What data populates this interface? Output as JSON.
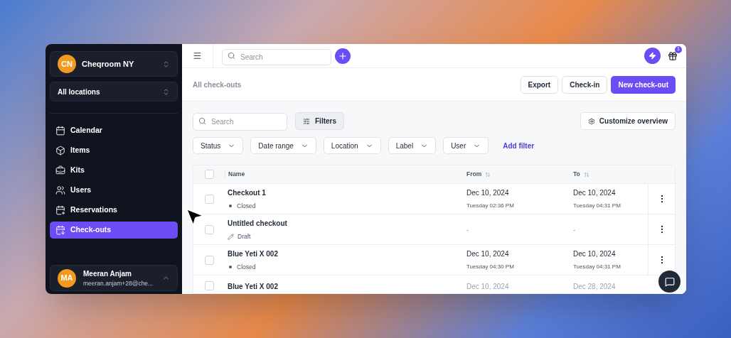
{
  "sidebar": {
    "org": {
      "initials": "CN",
      "name": "Cheqroom NY"
    },
    "location": "All locations",
    "items": [
      {
        "label": "Calendar",
        "selected": false
      },
      {
        "label": "Items",
        "selected": false
      },
      {
        "label": "Kits",
        "selected": false
      },
      {
        "label": "Users",
        "selected": false
      },
      {
        "label": "Reservations",
        "selected": false
      },
      {
        "label": "Check-outs",
        "selected": true
      }
    ],
    "user": {
      "initials": "MA",
      "name": "Meeran Anjam",
      "email": "meeran.anjam+28@che..."
    }
  },
  "topbar": {
    "search_placeholder": "Search",
    "badge": "1"
  },
  "header": {
    "title": "All check-outs",
    "buttons": [
      {
        "label": "Export",
        "kind": "outline"
      },
      {
        "label": "Check-in",
        "kind": "outline"
      },
      {
        "label": "New check-out",
        "kind": "primary"
      }
    ]
  },
  "toolbar": {
    "search_placeholder": "Search",
    "filters_button": "Filters",
    "customize_button": "Customize overview",
    "filters": [
      "Status",
      "Date range",
      "Location",
      "Label",
      "User"
    ],
    "add_filter": "Add filter"
  },
  "table": {
    "select_all_checked": false,
    "columns": [
      "Name",
      "From",
      "To"
    ],
    "rows": [
      {
        "checked": false,
        "name": "Checkout 1",
        "status": {
          "kind": "dot",
          "label": "Closed"
        },
        "from": {
          "date": "Dec 10, 2024",
          "time": "Tuesday 02:36 PM"
        },
        "to": {
          "date": "Dec 10, 2024",
          "time": "Tuesday 04:31 PM"
        }
      },
      {
        "checked": false,
        "name": "Untitled checkout",
        "status": {
          "kind": "pencil",
          "label": "Draft"
        },
        "from": {
          "date": "-"
        },
        "to": {
          "date": "-"
        }
      },
      {
        "checked": false,
        "name": "Blue Yeti X 002",
        "status": {
          "kind": "dot",
          "label": "Closed"
        },
        "from": {
          "date": "Dec 10, 2024",
          "time": "Tuesday 04:30 PM"
        },
        "to": {
          "date": "Dec 10, 2024",
          "time": "Tuesday 04:31 PM"
        }
      },
      {
        "checked": false,
        "name": "Blue Yeti X 002",
        "from": {
          "date": "Dec 10, 2024"
        },
        "to": {
          "date": "Dec 28, 2024"
        }
      }
    ]
  }
}
